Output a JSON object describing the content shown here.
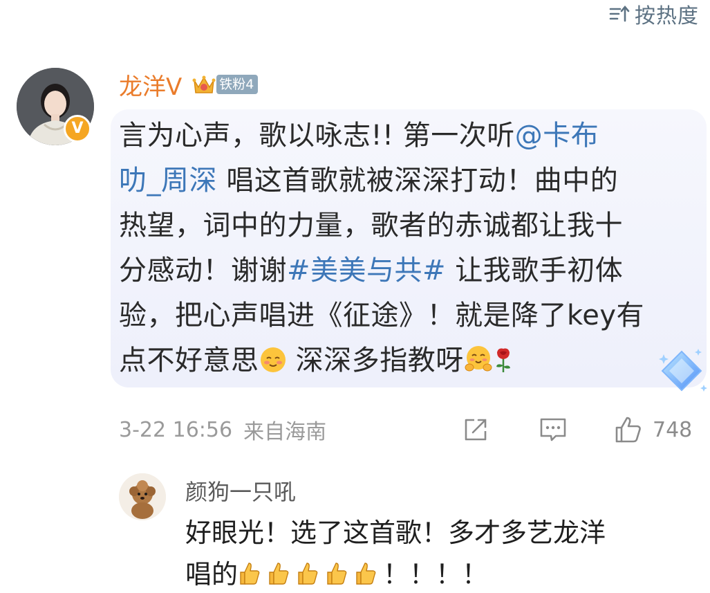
{
  "sort": {
    "label": "按热度",
    "icon": "sort-icon"
  },
  "comment": {
    "username": "龙洋V",
    "badge": "铁粉4",
    "lines": [
      {
        "a": "言为心声，歌以咏志!!  第一次听",
        "b": "@卡布"
      },
      {
        "a": "叻_周深",
        "b": " 唱这首歌就被深深打动！曲中的"
      },
      {
        "a": "热望，词中的力量，歌者的赤诚都让我十"
      },
      {
        "a": "分感动！谢谢",
        "b": "#美美与共#",
        "c": " 让我歌手初体"
      },
      {
        "a": "验，把心声唱进《征途》！就是降了key有"
      },
      {
        "a": "点不好意思",
        "b": " 深深多指教呀"
      }
    ],
    "time": "3-22 16:56",
    "location": "来自海南",
    "likes": "748",
    "emojis": [
      "blush-emoji",
      "hug-emoji",
      "rose-emoji"
    ]
  },
  "reply": {
    "username": "颜狗一只吼",
    "line1": "好眼光！选了这首歌！多才多艺龙洋",
    "line2_prefix": "唱的",
    "line2_suffix": "！！！！",
    "thumbs_count": 5
  },
  "colors": {
    "link": "#3d77b8",
    "username": "#ea7c2b",
    "badge_bg": "#8fa8bb",
    "meta_gray": "#9a9a9a"
  }
}
